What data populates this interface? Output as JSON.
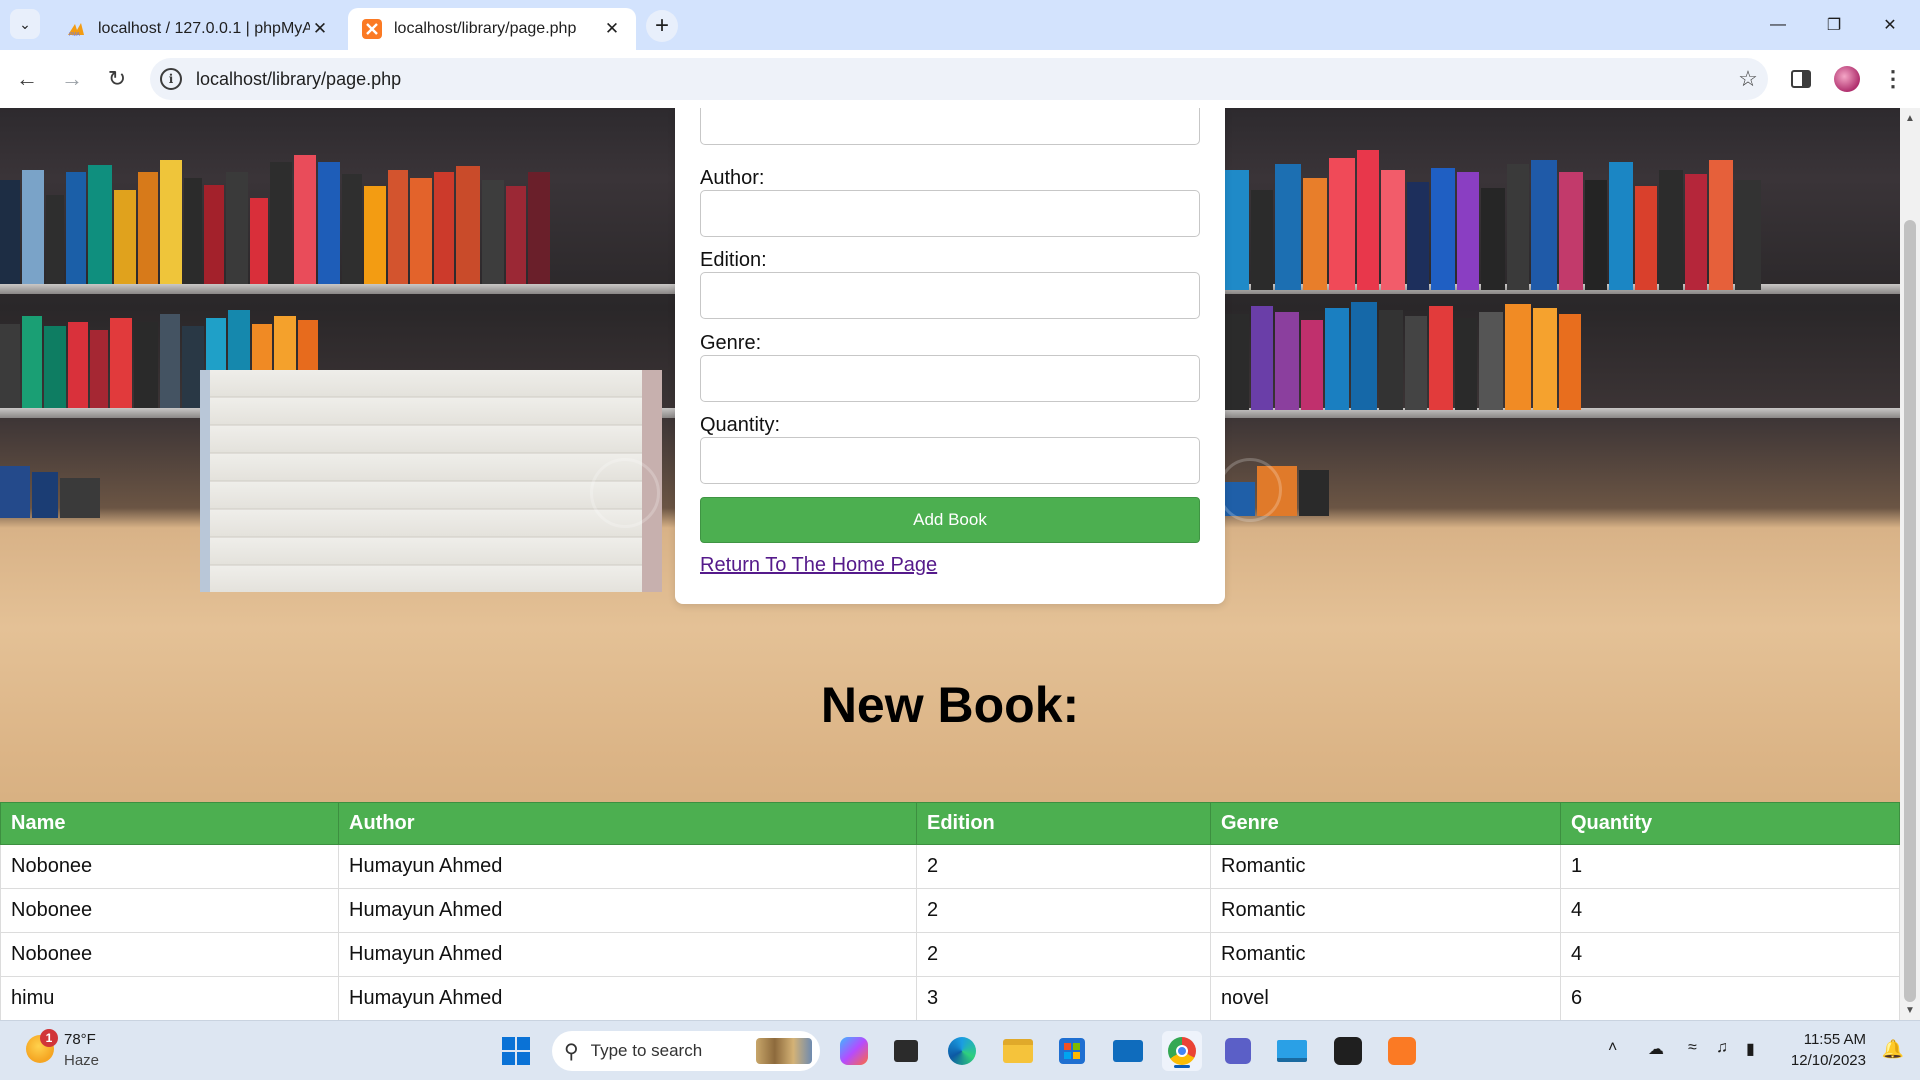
{
  "browser": {
    "tabs": [
      {
        "title": "localhost / 127.0.0.1 | phpMyAdmin",
        "favicon": "phpmyadmin-icon",
        "active": false
      },
      {
        "title": "localhost/library/page.php",
        "favicon": "xampp-icon",
        "active": true
      }
    ],
    "url": "localhost/library/page.php"
  },
  "form": {
    "labels": {
      "author": "Author:",
      "edition": "Edition:",
      "genre": "Genre:",
      "quantity": "Quantity:"
    },
    "values": {
      "name": "",
      "author": "",
      "edition": "",
      "genre": "",
      "quantity": ""
    },
    "add_button": "Add Book",
    "home_link": "Return To The Home Page"
  },
  "heading": "New Book:",
  "table": {
    "columns": [
      "Name",
      "Author",
      "Edition",
      "Genre",
      "Quantity"
    ],
    "rows": [
      [
        "Nobonee",
        "Humayun Ahmed",
        "2",
        "Romantic",
        "1"
      ],
      [
        "Nobonee",
        "Humayun Ahmed",
        "2",
        "Romantic",
        "4"
      ],
      [
        "Nobonee",
        "Humayun Ahmed",
        "2",
        "Romantic",
        "4"
      ],
      [
        "himu",
        "Humayun Ahmed",
        "3",
        "novel",
        "6"
      ]
    ]
  },
  "taskbar": {
    "weather": {
      "temp": "78°F",
      "desc": "Haze",
      "badge": "1"
    },
    "search_placeholder": "Type to search",
    "clock": {
      "time": "11:55 AM",
      "date": "12/10/2023"
    }
  },
  "colors": {
    "accent_green": "#4caf50",
    "link_visited": "#551a8b"
  }
}
